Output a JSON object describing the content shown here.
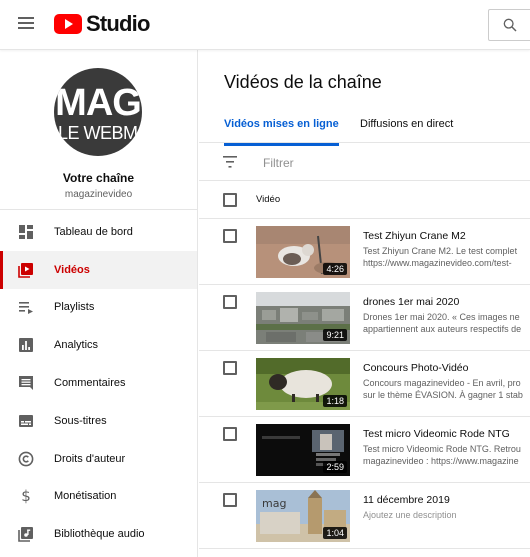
{
  "header": {
    "logo_text": "Studio",
    "menu_icon": "hamburger-menu-icon",
    "search_icon": "search-icon"
  },
  "sidebar": {
    "channel_title": "Votre chaîne",
    "channel_name": "magazinevideo",
    "avatar_line1": "MAG",
    "avatar_line2": "LE WEBMA",
    "items": [
      {
        "label": "Tableau de bord",
        "icon": "dashboard-icon",
        "active": false
      },
      {
        "label": "Vidéos",
        "icon": "video-library-icon",
        "active": true
      },
      {
        "label": "Playlists",
        "icon": "playlist-icon",
        "active": false
      },
      {
        "label": "Analytics",
        "icon": "analytics-icon",
        "active": false
      },
      {
        "label": "Commentaires",
        "icon": "comment-icon",
        "active": false
      },
      {
        "label": "Sous-titres",
        "icon": "subtitles-icon",
        "active": false
      },
      {
        "label": "Droits d'auteur",
        "icon": "copyright-icon",
        "active": false
      },
      {
        "label": "Monétisation",
        "icon": "dollar-icon",
        "active": false
      },
      {
        "label": "Bibliothèque audio",
        "icon": "audio-library-icon",
        "active": false
      }
    ]
  },
  "main": {
    "title": "Vidéos de la chaîne",
    "tabs": [
      {
        "label": "Vidéos mises en ligne",
        "active": true
      },
      {
        "label": "Diffusions en direct",
        "active": false
      }
    ],
    "filter_placeholder": "Filtrer",
    "column_video": "Vidéo",
    "videos": [
      {
        "title": "Test Zhiyun Crane M2",
        "desc1": "Test Zhiyun Crane M2. Le test complet",
        "desc2": "https://www.magazinevideo.com/test-",
        "duration": "4:26",
        "thumb": "cat"
      },
      {
        "title": "drones 1er mai 2020",
        "desc1": "Drones 1er mai 2020. « Ces images ne",
        "desc2": "appartiennent aux auteurs respectifs de",
        "duration": "9:21",
        "thumb": "city"
      },
      {
        "title": "Concours Photo-Vidéo",
        "desc1": "Concours magazinevideo - En avril, pro",
        "desc2": "sur le thème ÉVASION. À gagner 1 stab",
        "duration": "1:18",
        "thumb": "sheep"
      },
      {
        "title": "Test micro Videomic Rode NTG",
        "desc1": "Test micro Videomic Rode NTG. Retrou",
        "desc2": "magazinevideo : https://www.magazine",
        "duration": "2:59",
        "thumb": "dark"
      },
      {
        "title": "11 décembre 2019",
        "desc1": "Ajoutez une description",
        "desc2": "",
        "duration": "1:04",
        "thumb": "church",
        "placeholder": true
      }
    ]
  }
}
